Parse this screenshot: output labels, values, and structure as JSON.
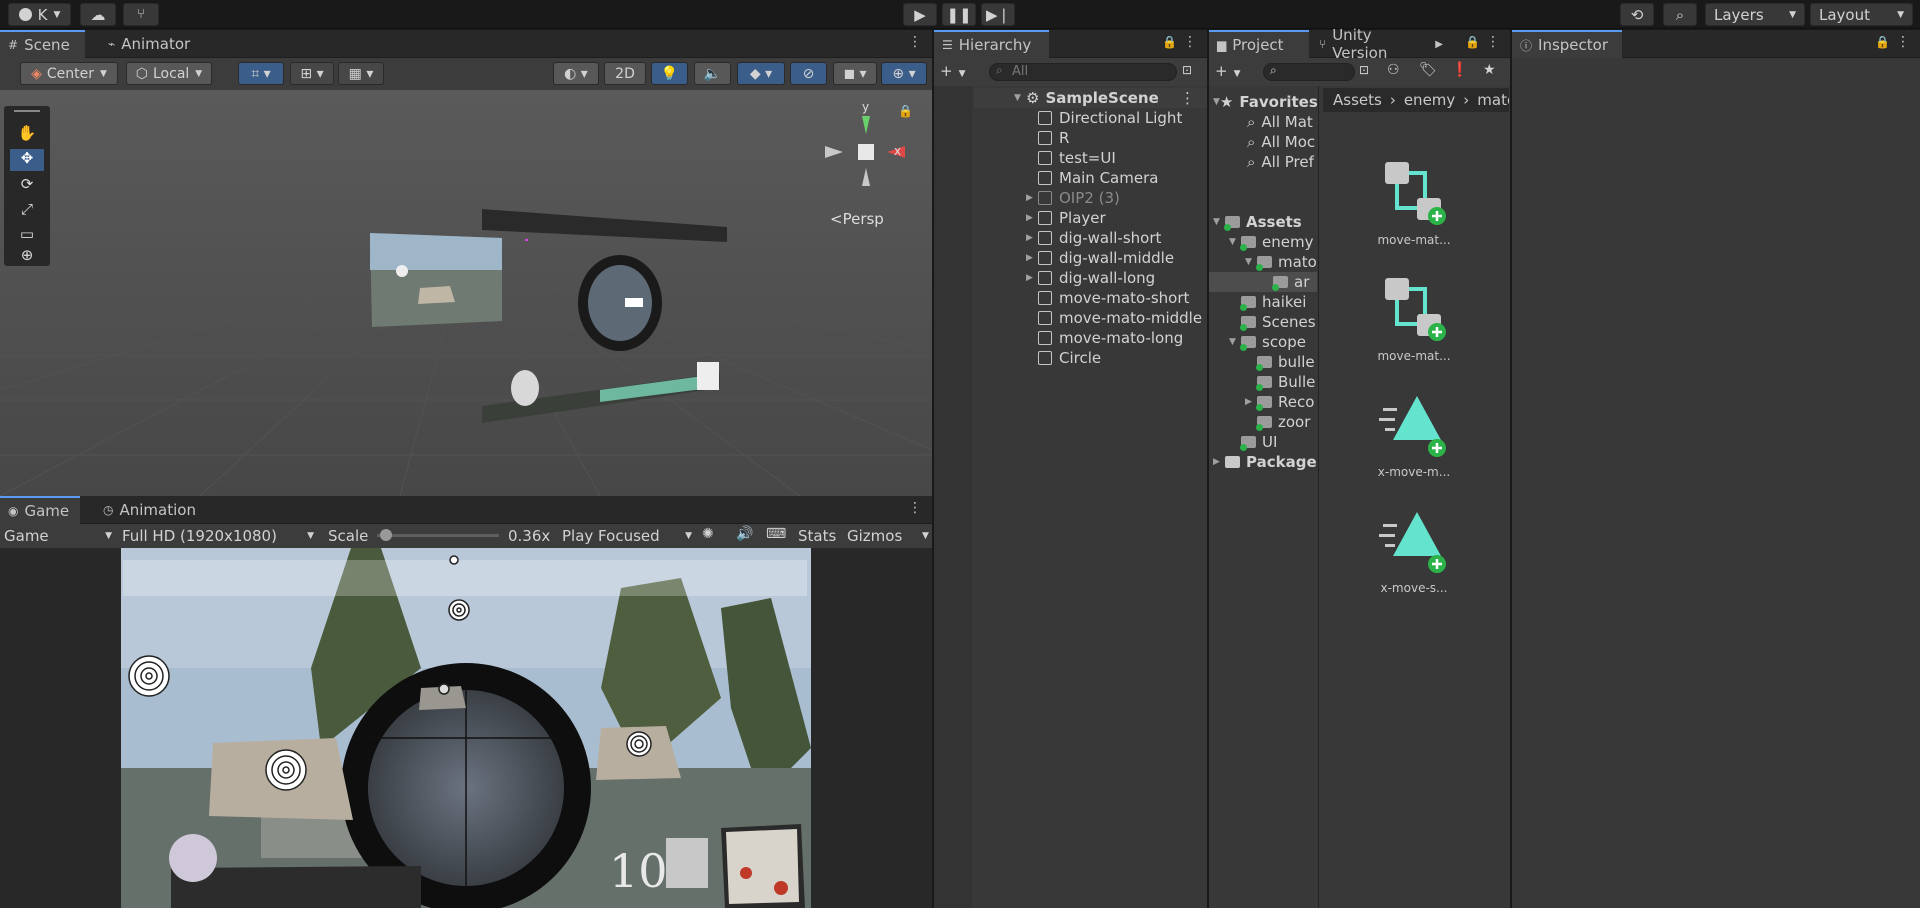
{
  "topbar": {
    "account": "K",
    "layers_label": "Layers",
    "layout_label": "Layout"
  },
  "scene_panel": {
    "tabs": [
      {
        "label": "Scene"
      },
      {
        "label": "Animator"
      }
    ],
    "pivot": "Center",
    "space": "Local",
    "mode_2d": "2D",
    "view_label": "Persp",
    "gizmo_axes": {
      "y": "y",
      "x": "x"
    }
  },
  "game_panel": {
    "tabs": [
      {
        "label": "Game"
      },
      {
        "label": "Animation"
      }
    ],
    "display": "Game",
    "resolution": "Full HD (1920x1080)",
    "scale_label": "Scale",
    "scale_value": "0.36x",
    "scale_level": 0.03,
    "play_mode": "Play Focused",
    "stats": "Stats",
    "gizmos": "Gizmos"
  },
  "hierarchy": {
    "tab": "Hierarchy",
    "search_placeholder": "All",
    "scene": "SampleScene",
    "items": [
      {
        "label": "Directional Light",
        "expandable": false,
        "dim": false
      },
      {
        "label": "R",
        "expandable": false,
        "dim": false
      },
      {
        "label": "test=UI",
        "expandable": false,
        "dim": false
      },
      {
        "label": "Main Camera",
        "expandable": false,
        "dim": false
      },
      {
        "label": "OIP2 (3)",
        "expandable": true,
        "dim": true
      },
      {
        "label": "Player",
        "expandable": true,
        "dim": false
      },
      {
        "label": "dig-wall-short",
        "expandable": true,
        "dim": false
      },
      {
        "label": "dig-wall-middle",
        "expandable": true,
        "dim": false
      },
      {
        "label": "dig-wall-long",
        "expandable": true,
        "dim": false
      },
      {
        "label": "move-mato-short",
        "expandable": false,
        "dim": false
      },
      {
        "label": "move-mato-middle",
        "expandable": false,
        "dim": false
      },
      {
        "label": "move-mato-long",
        "expandable": false,
        "dim": false
      },
      {
        "label": "Circle",
        "expandable": false,
        "dim": false
      }
    ]
  },
  "project": {
    "tabs": [
      {
        "label": "Project"
      },
      {
        "label": "Unity Version"
      }
    ],
    "favorites": "Favorites",
    "favorite_items": [
      "All Mat",
      "All Moc",
      "All Pref"
    ],
    "assets": "Assets",
    "tree": [
      {
        "label": "enemy",
        "indent": 1,
        "arrow": "▼"
      },
      {
        "label": "mato",
        "indent": 2,
        "arrow": "▼"
      },
      {
        "label": "ar",
        "indent": 3,
        "arrow": ""
      },
      {
        "label": "haikei",
        "indent": 1,
        "arrow": ""
      },
      {
        "label": "Scenes",
        "indent": 1,
        "arrow": ""
      },
      {
        "label": "scope",
        "indent": 1,
        "arrow": "▼"
      },
      {
        "label": "bulle",
        "indent": 2,
        "arrow": ""
      },
      {
        "label": "Bulle",
        "indent": 2,
        "arrow": ""
      },
      {
        "label": "Reco",
        "indent": 2,
        "arrow": "▶"
      },
      {
        "label": "zoor",
        "indent": 2,
        "arrow": ""
      },
      {
        "label": "UI",
        "indent": 1,
        "arrow": ""
      }
    ],
    "packages": "Package",
    "breadcrumb": [
      "Assets",
      "enemy",
      "mato"
    ],
    "assets_grid": [
      {
        "label": "move-mat...",
        "kind": "controller"
      },
      {
        "label": "move-mat...",
        "kind": "controller"
      },
      {
        "label": "x-move-m...",
        "kind": "clip"
      },
      {
        "label": "x-move-s...",
        "kind": "clip"
      }
    ]
  },
  "inspector": {
    "tab": "Inspector"
  },
  "game_view": {
    "ammo": "10"
  },
  "colors": {
    "accent_blue": "#3a5d8a",
    "tab_highlight": "#5a9af0",
    "plus_green": "#2bb34a",
    "teal": "#64e3cf"
  }
}
